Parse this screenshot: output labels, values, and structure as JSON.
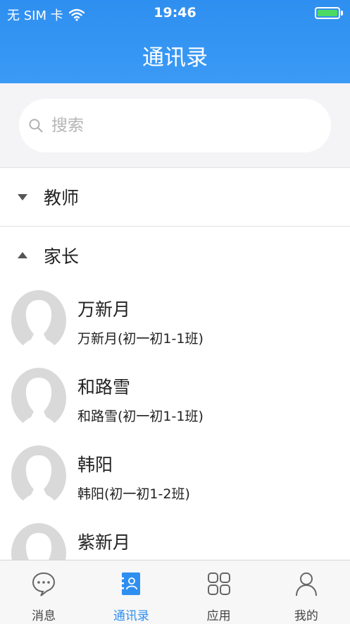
{
  "status_bar": {
    "carrier": "无 SIM 卡",
    "time": "19:46"
  },
  "header": {
    "title": "通讯录"
  },
  "search": {
    "placeholder": "搜索"
  },
  "groups": [
    {
      "label": "教师",
      "expanded": false
    },
    {
      "label": "家长",
      "expanded": true
    }
  ],
  "contacts": [
    {
      "name": "万新月",
      "subtitle": "万新月(初一初1-1班)"
    },
    {
      "name": "和路雪",
      "subtitle": "和路雪(初一初1-1班)"
    },
    {
      "name": "韩阳",
      "subtitle": "韩阳(初一初1-2班)"
    },
    {
      "name": "紫新月",
      "subtitle": ""
    }
  ],
  "tabbar": {
    "items": [
      {
        "label": "消息",
        "icon": "chat-bubble-icon",
        "active": false
      },
      {
        "label": "通讯录",
        "icon": "contacts-icon",
        "active": true
      },
      {
        "label": "应用",
        "icon": "apps-grid-icon",
        "active": false
      },
      {
        "label": "我的",
        "icon": "person-icon",
        "active": false
      }
    ]
  },
  "colors": {
    "accent": "#2f8ff0",
    "battery": "#4cd964",
    "avatar_placeholder": "#d9d9d9"
  }
}
